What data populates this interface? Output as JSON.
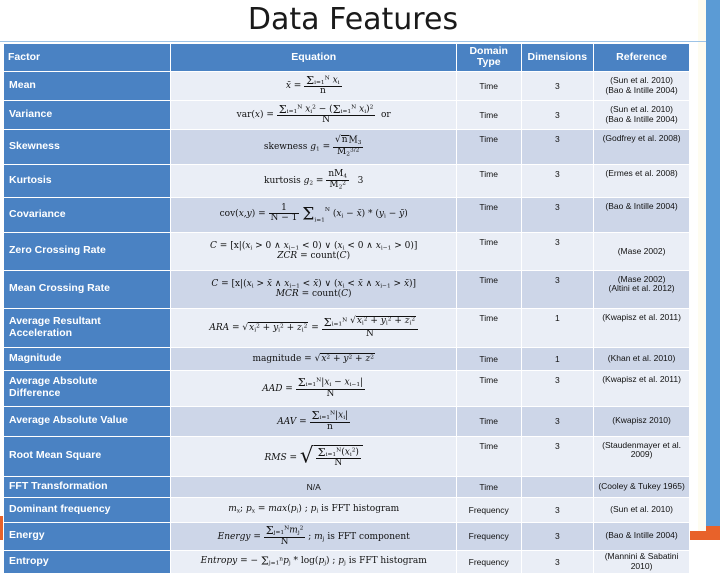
{
  "slide": {
    "title": "Data Features",
    "accent_blue": "#4A82C3",
    "accent_orange": "#E8622A",
    "row_odd_bg": "#EAEEF6",
    "row_even_bg": "#CDD6E8"
  },
  "table": {
    "headers": {
      "factor": "Factor",
      "equation": "Equation",
      "domain_type": "Domain Type",
      "domain_type_line1": "Domain",
      "domain_type_line2": "Type",
      "dimensions": "Dimensions",
      "reference": "Reference"
    },
    "rows": [
      {
        "factor": "Mean",
        "equation_text": "x̄ = ( Σ i=1..N xi ) / n",
        "domain": "Time",
        "dimensions": "3",
        "reference": [
          "(Sun et al. 2010)",
          "(Bao & Intille 2004)"
        ]
      },
      {
        "factor": "Variance",
        "equation_text": "var(x) = ( Σ i=1..N xi² − ( Σ i=1..N xi )² ) / N   or",
        "domain": "Time",
        "dimensions": "3",
        "reference": [
          "(Sun et al. 2010)",
          "(Bao & Intille 2004)"
        ]
      },
      {
        "factor": "Skewness",
        "equation_text": "skewness g1 = ( √n M3 ) / M2^(3/2)",
        "domain": "Time",
        "dimensions": "3",
        "reference": [
          "(Godfrey et al. 2008)"
        ]
      },
      {
        "factor": "Kurtosis",
        "equation_text": "kurtosis g2 = ( n M4 ) / M2²  − 3",
        "domain": "Time",
        "dimensions": "3",
        "reference": [
          "(Ermes et al. 2008)"
        ]
      },
      {
        "factor": "Covariance",
        "equation_text": "cov(x,y) = 1/(N−1) Σ i=1..N (xi − x̄) * (yi − ȳ)",
        "domain": "Time",
        "dimensions": "3",
        "reference": [
          "(Bao & Intille 2004)"
        ]
      },
      {
        "factor": "Zero Crossing Rate",
        "equation_text": "C = [x|(xi > 0 ∧ xi−1 < 0) ∨ (xi < 0 ∧ xi−1 > 0)]   ZCR = count(C)",
        "domain": "Time",
        "dimensions": "3",
        "reference": [
          "(Mase 2002)"
        ]
      },
      {
        "factor": "Mean Crossing Rate",
        "equation_text": "C = [x|(xi > x̄ ∧ xi−1 < x̄) ∨ (xi < x̄ ∧ xi−1 > x̄)]   MCR = count(C)",
        "domain": "Time",
        "dimensions": "3",
        "reference": [
          "(Mase 2002)",
          "(Altini et al. 2012)"
        ]
      },
      {
        "factor": "Average Resultant Acceleration",
        "equation_text": "ARA = √(xi² + yi² + zi²) = ( Σ i=1..N √(xi² + yi² + zi²) ) / N",
        "domain": "Time",
        "dimensions": "1",
        "reference": [
          "(Kwapisz et al. 2011)"
        ]
      },
      {
        "factor": "Magnitude",
        "equation_text": "magnitude = √(x² + y² + z²)",
        "domain": "Time",
        "dimensions": "1",
        "reference": [
          "(Khan et al. 2010)"
        ]
      },
      {
        "factor": "Average Absolute Difference",
        "equation_text": "AAD = ( Σ i=1..N |xi − xi−1| ) / N",
        "domain": "Time",
        "dimensions": "3",
        "reference": [
          "(Kwapisz et al. 2011)"
        ]
      },
      {
        "factor": "Average Absolute Value",
        "equation_text": "AAV = ( Σ i=1..N |xi| ) / n",
        "domain": "Time",
        "dimensions": "3",
        "reference": [
          "(Kwapisz 2010)"
        ]
      },
      {
        "factor": "Root Mean Square",
        "equation_text": "RMS = √( ( Σ i=1..N (xi²) ) / N )",
        "domain": "Time",
        "dimensions": "3",
        "reference": [
          "(Staudenmayer et al. 2009)"
        ]
      },
      {
        "factor": "FFT Transformation",
        "equation_text": "N/A",
        "domain": "Time",
        "dimensions": "",
        "reference": [
          "(Cooley & Tukey 1965)"
        ]
      },
      {
        "factor": "Dominant frequency",
        "equation_text": "mx; px = max(pi) ; pi is FFT histogram",
        "domain": "Frequency",
        "dimensions": "3",
        "reference": [
          "(Sun et al. 2010)"
        ]
      },
      {
        "factor": "Energy",
        "equation_text": "Energy = ( Σ j=1..N mj² ) / N ; mj is FFT component",
        "domain": "Frequency",
        "dimensions": "3",
        "reference": [
          "(Bao & Intille 2004)"
        ]
      },
      {
        "factor": "Entropy",
        "equation_text": "Entropy = − Σ j=1..n pj * log(pj) ; pj is FFT histogram",
        "domain": "Frequency",
        "dimensions": "3",
        "reference": [
          "(Mannini & Sabatini 2010)"
        ]
      }
    ]
  }
}
